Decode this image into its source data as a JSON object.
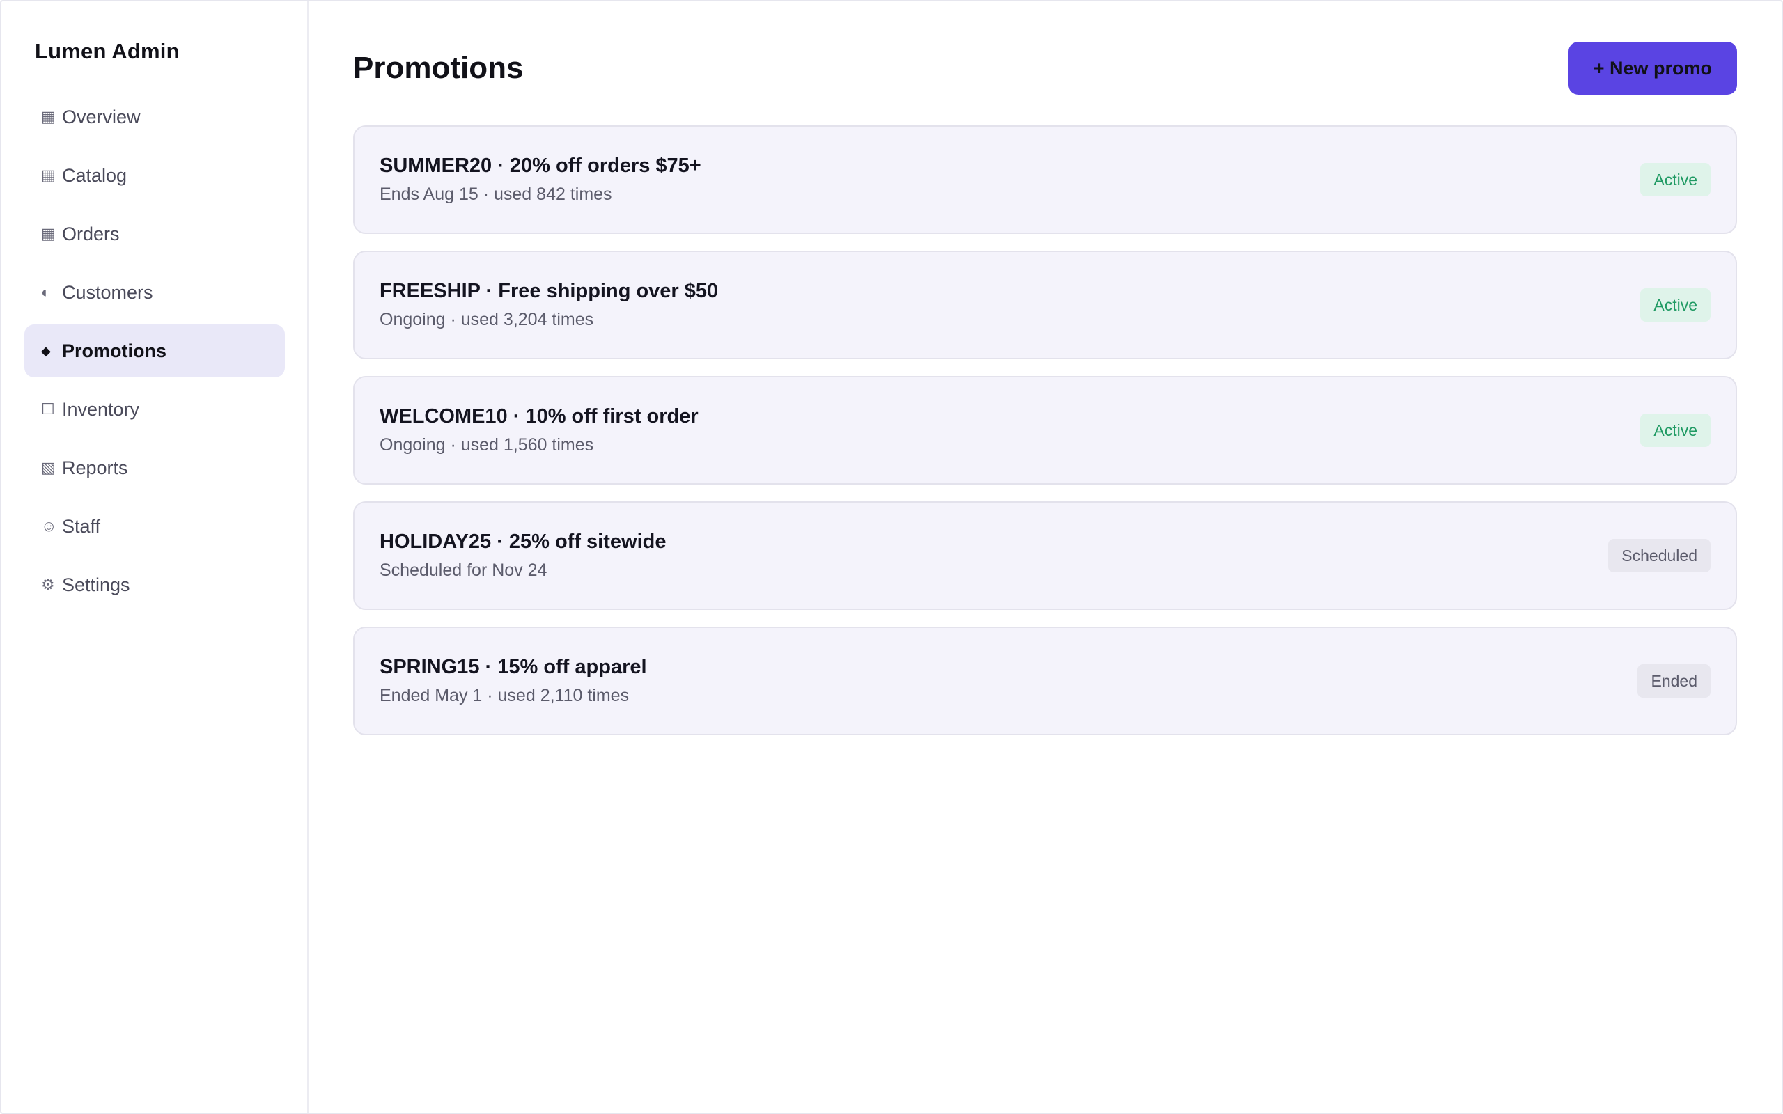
{
  "app": {
    "brand": "Lumen Admin"
  },
  "sidebar": {
    "items": [
      {
        "icon": "▦",
        "icon_name": "overview-icon",
        "label": "Overview",
        "active": false
      },
      {
        "icon": "▦",
        "icon_name": "catalog-icon",
        "label": "Catalog",
        "active": false
      },
      {
        "icon": "▦",
        "icon_name": "orders-icon",
        "label": "Orders",
        "active": false
      },
      {
        "icon": "◐",
        "icon_name": "customers-icon",
        "label": "Customers",
        "active": false
      },
      {
        "icon": "◆",
        "icon_name": "promotions-icon",
        "label": "Promotions",
        "active": true
      },
      {
        "icon": "☐",
        "icon_name": "inventory-icon",
        "label": "Inventory",
        "active": false
      },
      {
        "icon": "▧",
        "icon_name": "reports-icon",
        "label": "Reports",
        "active": false
      },
      {
        "icon": "☺",
        "icon_name": "staff-icon",
        "label": "Staff",
        "active": false
      },
      {
        "icon": "⚙",
        "icon_name": "settings-icon",
        "label": "Settings",
        "active": false
      }
    ]
  },
  "main": {
    "title": "Promotions",
    "new_button_label": "+ New promo",
    "promotions": [
      {
        "title": "SUMMER20 · 20% off orders $75+",
        "subtitle": "Ends Aug 15 · used 842 times",
        "status": "Active",
        "status_kind": "active"
      },
      {
        "title": "FREESHIP · Free shipping over $50",
        "subtitle": "Ongoing · used 3,204 times",
        "status": "Active",
        "status_kind": "active"
      },
      {
        "title": "WELCOME10 · 10% off first order",
        "subtitle": "Ongoing · used 1,560 times",
        "status": "Active",
        "status_kind": "active"
      },
      {
        "title": "HOLIDAY25 · 25% off sitewide",
        "subtitle": "Scheduled for Nov 24",
        "status": "Scheduled",
        "status_kind": "scheduled"
      },
      {
        "title": "SPRING15 · 15% off apparel",
        "subtitle": "Ended May 1 · used 2,110 times",
        "status": "Ended",
        "status_kind": "ended"
      }
    ]
  },
  "colors": {
    "accent": "#5a44e3",
    "active_nav_bg": "#e9e8f8",
    "card_bg": "#f4f3fb",
    "status_active_bg": "#dff3ea",
    "status_active_text": "#1f9a63",
    "status_muted_bg": "#e8e7ef"
  }
}
